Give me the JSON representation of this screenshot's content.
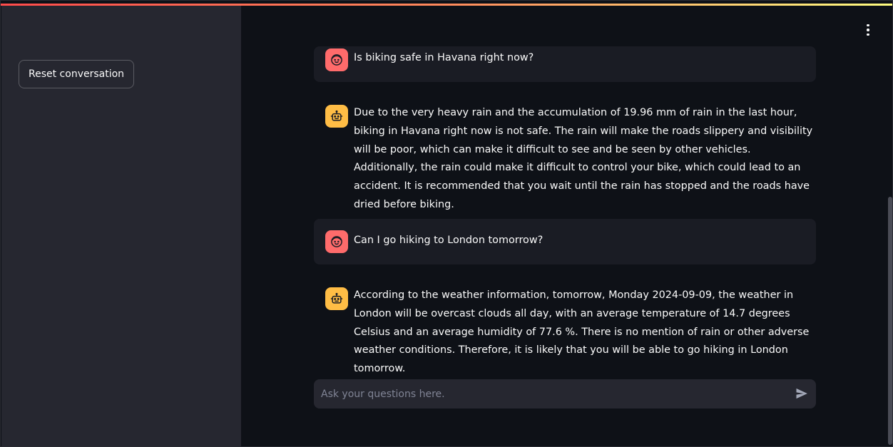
{
  "sidebar": {
    "reset_button_label": "Reset conversation"
  },
  "header": {
    "menu_icon": "vertical-ellipsis-icon"
  },
  "messages": [
    {
      "role": "user",
      "avatar_icon": "smiling-face-icon",
      "text": "Is biking safe in Havana right now?"
    },
    {
      "role": "assistant",
      "avatar_icon": "robot-icon",
      "text": "Due to the very heavy rain and the accumulation of 19.96 mm of rain in the last hour, biking in Havana right now is not safe. The rain will make the roads slippery and visibility will be poor, which can make it difficult to see and be seen by other vehicles. Additionally, the rain could make it difficult to control your bike, which could lead to an accident. It is recommended that you wait until the rain has stopped and the roads have dried before biking."
    },
    {
      "role": "user",
      "avatar_icon": "smiling-face-icon",
      "text": "Can I go hiking to London tomorrow?"
    },
    {
      "role": "assistant",
      "avatar_icon": "robot-icon",
      "text": "According to the weather information, tomorrow, Monday 2024-09-09, the weather in London will be overcast clouds all day, with an average temperature of 14.7 degrees Celsius and an average humidity of 77.6 %. There is no mention of rain or other adverse weather conditions. Therefore, it is likely that you will be able to go hiking in London tomorrow."
    }
  ],
  "chat_input": {
    "placeholder": "Ask your questions here.",
    "value": "",
    "send_icon": "send-arrow-icon"
  },
  "colors": {
    "background": "#0e1117",
    "sidebar": "#262730",
    "user_avatar": "#ff6b6b",
    "bot_avatar": "#ffbd45",
    "accent_gradient_start": "#ff4b4b",
    "accent_gradient_end": "#fffd80"
  }
}
